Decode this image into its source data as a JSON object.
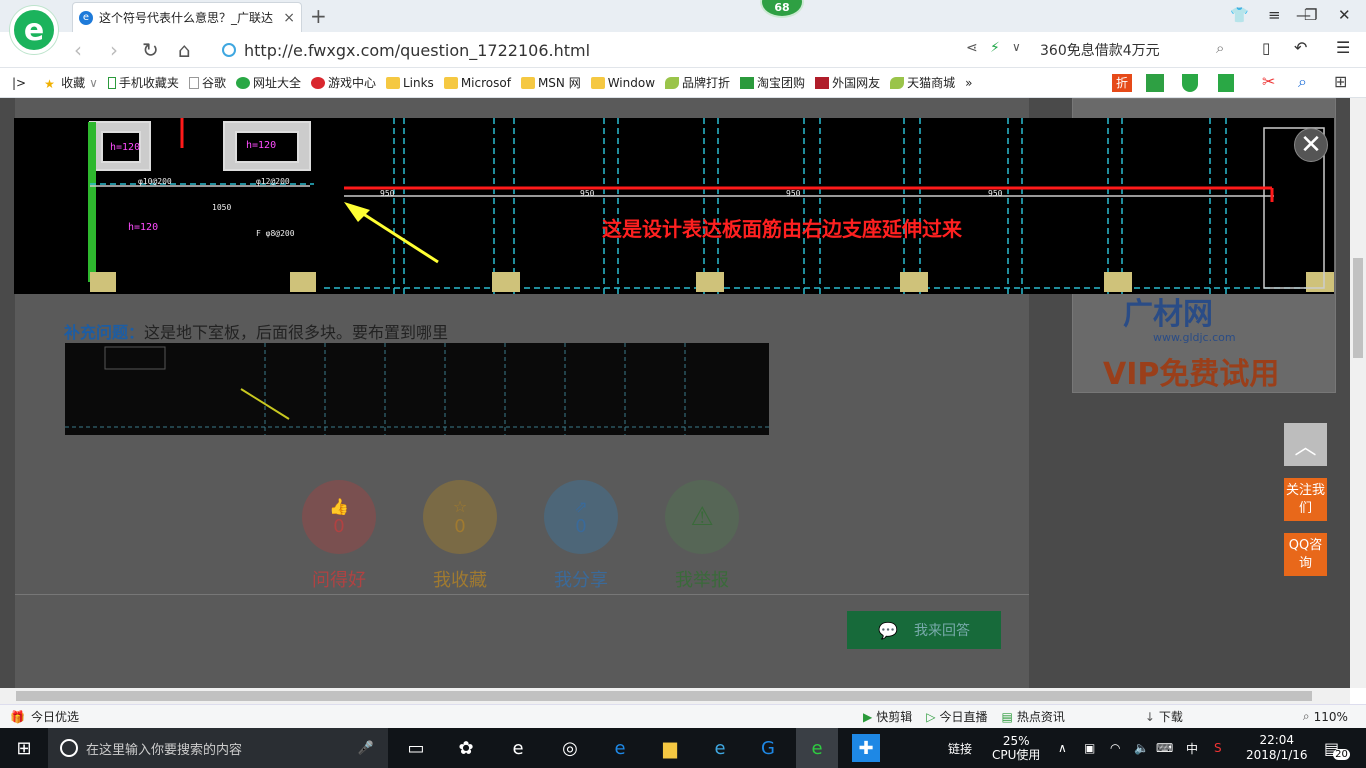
{
  "browser": {
    "tab_title": "这个符号代表什么意思？_广联达",
    "tab_close": "×",
    "new_tab": "+",
    "badge": "68",
    "url": "http://e.fwxgx.com/question_1722106.html",
    "search_text": "360免息借款4万元",
    "logo": "e"
  },
  "bookmarks": [
    {
      "label": "收藏",
      "icon": "star-icon"
    },
    {
      "label": "手机收藏夹",
      "icon": "phone-icon"
    },
    {
      "label": "谷歌",
      "icon": "page-icon"
    },
    {
      "label": "网址大全",
      "icon": "globe-icon"
    },
    {
      "label": "游戏中心",
      "icon": "game-icon"
    },
    {
      "label": "Links",
      "icon": "folder-icon"
    },
    {
      "label": "Microsof",
      "icon": "folder-icon"
    },
    {
      "label": "MSN 网",
      "icon": "folder-icon"
    },
    {
      "label": "Window",
      "icon": "folder-icon"
    },
    {
      "label": "品牌打折",
      "icon": "leaf-icon"
    },
    {
      "label": "淘宝团购",
      "icon": "taobao-icon"
    },
    {
      "label": "外国网友",
      "icon": "flag-icon"
    },
    {
      "label": "天猫商城",
      "icon": "leaf-icon"
    }
  ],
  "bookmarks_more": "»",
  "cad": {
    "annotation": "这是设计表达板面筋由右边支座延伸过来",
    "labels": [
      "h=120",
      "h=120",
      "φ10@200",
      "φ12@200",
      "h=120",
      "F φ8@200",
      "1050",
      "950",
      "950",
      "950",
      "950"
    ]
  },
  "question": {
    "supplement_label": "补充问题：",
    "supplement_text": "这是地下室板，后面很多块。要布置到哪里"
  },
  "actions": [
    {
      "label": "问得好",
      "count": "0",
      "color": "#b04242",
      "bg": "#7a5050",
      "icon": "thumb-up-icon"
    },
    {
      "label": "我收藏",
      "count": "0",
      "color": "#a07a30",
      "bg": "#7a6a45",
      "icon": "star-icon"
    },
    {
      "label": "我分享",
      "count": "0",
      "color": "#3a6a9a",
      "bg": "#4d6678",
      "icon": "share-icon"
    },
    {
      "label": "我举报",
      "count": "",
      "color": "#3a6a3a",
      "bg": "#566656",
      "icon": "warning-icon"
    }
  ],
  "answer_button": "我来回答",
  "sidebar_ad": {
    "brand": "广材网",
    "domain": "www.gldjc.com",
    "promo": "VIP免费试用"
  },
  "float": {
    "follow": "关注我们",
    "qq": "QQ咨询",
    "top": "︿"
  },
  "statusbar": {
    "left": "今日优选",
    "items": [
      "快剪辑",
      "今日直播",
      "热点资讯"
    ],
    "download": "下载",
    "zoom": "110%"
  },
  "taskbar": {
    "search_placeholder": "在这里输入你要搜索的内容",
    "cpu_percent": "25%",
    "cpu_label": "CPU使用",
    "link": "链接",
    "ime": "中",
    "time": "22:04",
    "date": "2018/1/16",
    "notif_count": "20"
  }
}
